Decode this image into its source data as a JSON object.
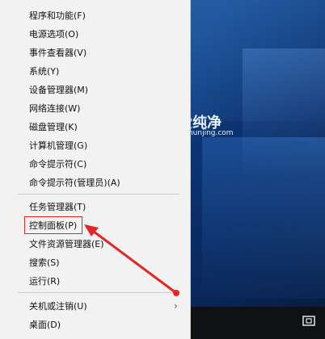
{
  "menu": {
    "items": [
      {
        "id": "programs",
        "label": "程序和功能(F)"
      },
      {
        "id": "power",
        "label": "电源选项(O)"
      },
      {
        "id": "eventviewer",
        "label": "事件查看器(V)"
      },
      {
        "id": "system",
        "label": "系统(Y)"
      },
      {
        "id": "devicemgr",
        "label": "设备管理器(M)"
      },
      {
        "id": "network",
        "label": "网络连接(W)"
      },
      {
        "id": "disk",
        "label": "磁盘管理(K)"
      },
      {
        "id": "computermgmt",
        "label": "计算机管理(G)"
      },
      {
        "id": "cmd",
        "label": "命令提示符(C)"
      },
      {
        "id": "cmdadmin",
        "label": "命令提示符(管理员)(A)"
      },
      {
        "id": "taskmgr",
        "label": "任务管理器(T)"
      },
      {
        "id": "controlpanel",
        "label": "控制面板(P)"
      },
      {
        "id": "explorer",
        "label": "文件资源管理器(E)"
      },
      {
        "id": "search",
        "label": "搜索(S)"
      },
      {
        "id": "run",
        "label": "运行(R)"
      },
      {
        "id": "shutdown",
        "label": "关机或注销(U)"
      },
      {
        "id": "desktop",
        "label": "桌面(D)"
      }
    ],
    "submenu_glyph": "›"
  },
  "watermark": {
    "name": "爱纯净",
    "url": "aichunjing.com"
  },
  "colors": {
    "highlight": "#e32626",
    "menu_bg": "#f2f2f2",
    "desktop": "#0e3f82"
  },
  "icons": {
    "watermark_logo": "logo-icon",
    "tray": "tray-icon"
  }
}
